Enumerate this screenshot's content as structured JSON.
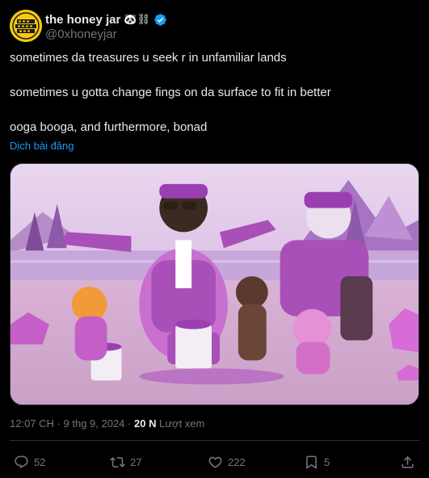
{
  "author": {
    "display_name": "the honey jar",
    "name_emojis": "🐼⛓",
    "handle": "@0xhoneyjar",
    "avatar_text": "THE HONEY JAR"
  },
  "tweet": {
    "lines": [
      "sometimes da treasures u seek r in unfamiliar lands",
      "sometimes u gotta change fings on da surface to fit in better",
      "ooga booga, and furthermore, bonad"
    ],
    "translate_label": "Dịch bài đăng"
  },
  "meta": {
    "time": "12:07 CH",
    "separator": "·",
    "date": "9 thg 9, 2024",
    "views_count": "20 N",
    "views_label": "Lượt xem"
  },
  "actions": {
    "replies": "52",
    "reposts": "27",
    "likes": "222",
    "bookmarks": "5"
  },
  "colors": {
    "background": "#000000",
    "text": "#e7e9ea",
    "secondary": "#71767b",
    "link": "#1d9bf0",
    "verified": "#1d9bf0",
    "media_purple": "#b25fc4"
  }
}
